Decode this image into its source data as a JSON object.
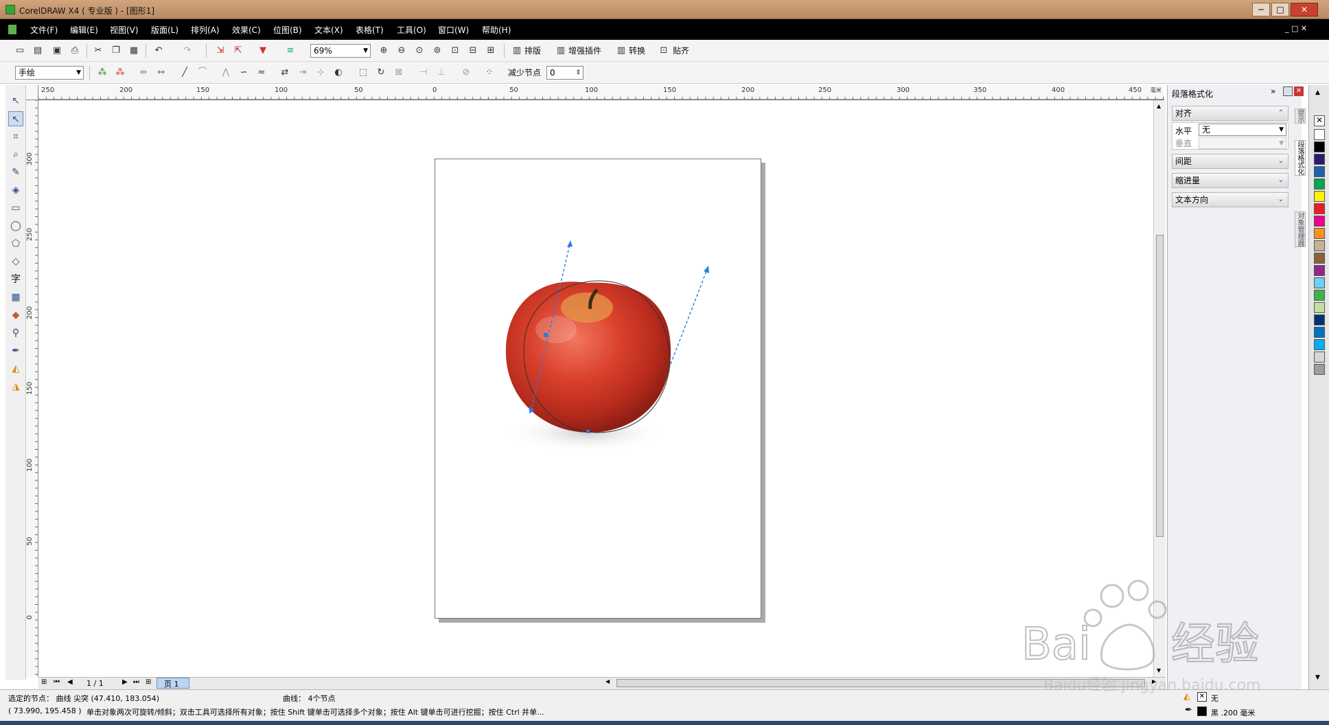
{
  "window": {
    "title": "CorelDRAW X4 ( 专业版 ) - [图形1]",
    "controls": [
      "─",
      "□",
      "✕"
    ]
  },
  "menu": [
    "文件(F)",
    "编辑(E)",
    "视图(V)",
    "版面(L)",
    "排列(A)",
    "效果(C)",
    "位图(B)",
    "文本(X)",
    "表格(T)",
    "工具(O)",
    "窗口(W)",
    "帮助(H)"
  ],
  "toolbar": {
    "zoom": "69%",
    "layout_btn": "排版",
    "plugin_btn": "增强插件",
    "convert_btn": "转换",
    "snap_btn": "贴齐"
  },
  "property_bar": {
    "mode": "手绘",
    "reduce_nodes_label": "减少节点",
    "reduce_nodes_value": "0"
  },
  "rulers": {
    "h_ticks": [
      "250",
      "200",
      "150",
      "100",
      "50",
      "0",
      "50",
      "100",
      "150",
      "200",
      "250",
      "300",
      "350",
      "400",
      "450"
    ],
    "v_ticks": [
      "300",
      "250",
      "200",
      "150",
      "100",
      "50",
      "0"
    ],
    "unit": "毫米"
  },
  "docker": {
    "title": "段落格式化",
    "align_section": "对齐",
    "horizontal_label": "水平",
    "horizontal_value": "无",
    "vertical_label": "垂直",
    "spacing_section": "间距",
    "indent_section": "缩进量",
    "text_direction_section": "文本方向",
    "tabs": [
      "提示",
      "段落格式化",
      "对象管理器"
    ]
  },
  "page_nav": {
    "counter": "1 / 1",
    "page_tab": "页 1"
  },
  "status": {
    "selected_node": "选定的节点： 曲线 尖突 (47.410, 183.054)",
    "curve_info": "曲线： 4个节点",
    "coords": "( 73.990, 195.458 )",
    "hint": "单击对象两次可旋转/倾斜；双击工具可选择所有对象；按住 Shift 键单击可选择多个对象；按住 Alt 键单击可进行挖掘；按住 Ctrl 并单...",
    "fill": "无",
    "outline": "黑 .200 毫米"
  },
  "palette_colors": [
    "#ffffff",
    "#000000",
    "#2d1a6e",
    "#1e5fae",
    "#00a651",
    "#fff200",
    "#ed1c24",
    "#ec008c",
    "#f7941d",
    "#c7b299",
    "#8c6239",
    "#92278f",
    "#6dcff6",
    "#39b54a",
    "#c4df9b",
    "#003471",
    "#0072bc",
    "#00aeef",
    "#d7d7d7",
    "#9e9e9e"
  ],
  "watermark": "Baidu经验 jingyan.baidu.com"
}
